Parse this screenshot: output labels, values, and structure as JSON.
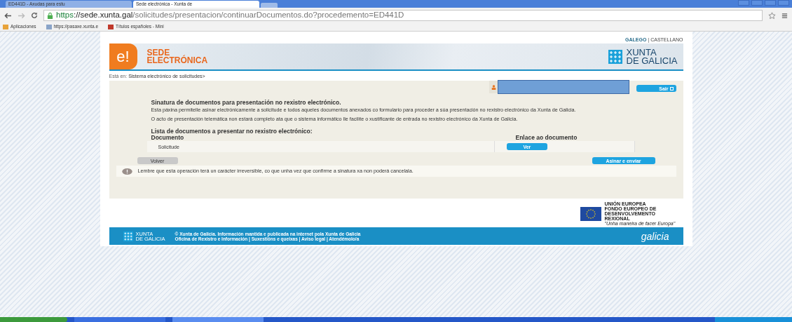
{
  "browser": {
    "tabs": [
      {
        "title": "ED441D - Axudas para estu",
        "selected": false
      },
      {
        "title": "Sede electrónica - Xunta de",
        "selected": true
      }
    ],
    "url": {
      "scheme": "https",
      "host": "://sede.xunta.gal",
      "path": "/solicitudes/presentacion/continuarDocumentos.do?procedemento=ED441D"
    },
    "bookmarks": [
      {
        "label": "Aplicaciones"
      },
      {
        "label": "https://pasaxe.xunta.e"
      },
      {
        "label": "Títulos españoles - Mini"
      }
    ]
  },
  "page": {
    "language_separator": "|",
    "languages": [
      {
        "label": "GALEGO",
        "selected": true
      },
      {
        "label": "CASTELLANO",
        "selected": false
      }
    ],
    "header": {
      "logo_mark": "e!",
      "title_lines": [
        "SEDE",
        "ELECTRÓNICA"
      ],
      "brand_lines": [
        "XUNTA",
        "DE GALICIA"
      ]
    },
    "breadcrumb": {
      "prefix": "Está en:",
      "path": "Sistema electrónico de solicitudes>"
    },
    "logout": "Sair",
    "heading": "Sinatura de documentos para presentación no rexistro electrónico.",
    "paragraphs": [
      "Esta páxina permitelle asinar electrónicamente a solicitude e todos aqueles documentos anexados co formulario para proceder a súa presentación no rexistro electrónico da Xunta de Galicia.",
      "O acto de presentación telemática non estará completo ata que o sistema informático lle facilite o xustificante de entrada no rexistro electrónico da Xunta de Galicia."
    ],
    "list_title": "Lista de documentos a presentar no rexistro electrónico:",
    "table": {
      "columns": [
        "Documento",
        "Enlace ao documento"
      ],
      "rows": [
        {
          "document": "Solicitude",
          "action": "Ver"
        }
      ]
    },
    "back": "Volver",
    "submit": "Asinar e enviar",
    "warning": "Lembre que esta operación terá un carácter irreversible, co que unha vez que confirme a sinatura xa non poderá cancelala.",
    "eu_lines": [
      "UNIÓN EUROPEA",
      "FONDO EUROPEO DE",
      "DESENVOLVEMENTO",
      "REXIONAL",
      "\"Unha maneira de facer Europa\""
    ],
    "footer": {
      "brand_lines": [
        "XUNTA",
        "DE GALICIA"
      ],
      "copyright": "© Xunta de Galicia. Información mantida e publicada na internet pola Xunta de Galicia",
      "links": "Oficina de Rexistro e Información | Suxestións e queixas | Aviso legal | Atendémolo/a",
      "logo": "galicia"
    }
  }
}
